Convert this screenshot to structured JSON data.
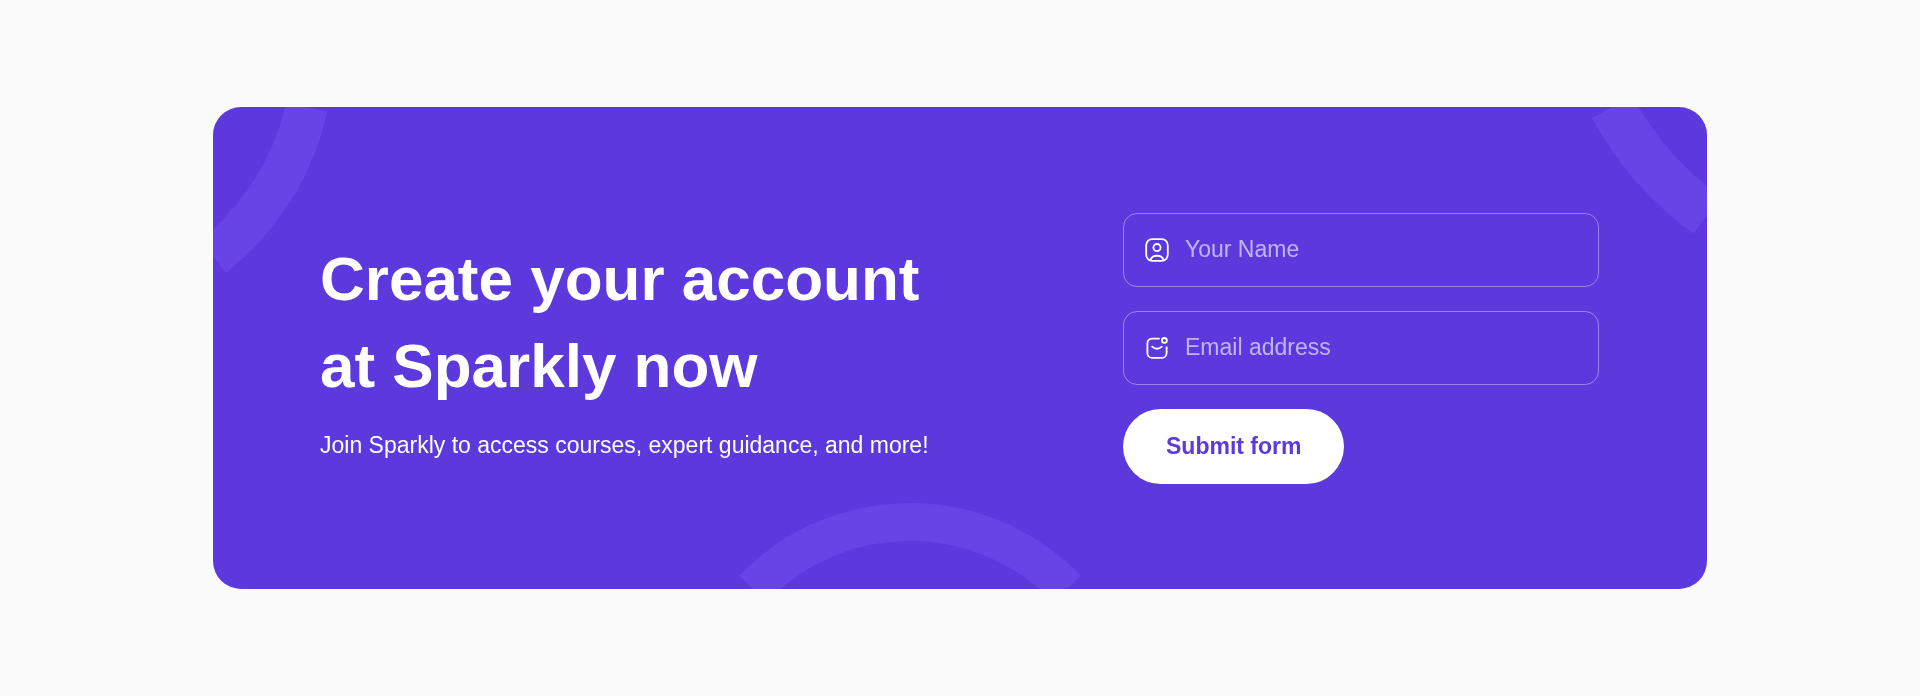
{
  "heading": "Create your account at Sparkly now",
  "subtitle": "Join Sparkly to access courses, expert guidance, and more!",
  "form": {
    "fields": [
      {
        "kind": "name",
        "placeholder": "Your Name"
      },
      {
        "kind": "email",
        "placeholder": "Email address"
      }
    ],
    "submit_button": "Submit form"
  }
}
